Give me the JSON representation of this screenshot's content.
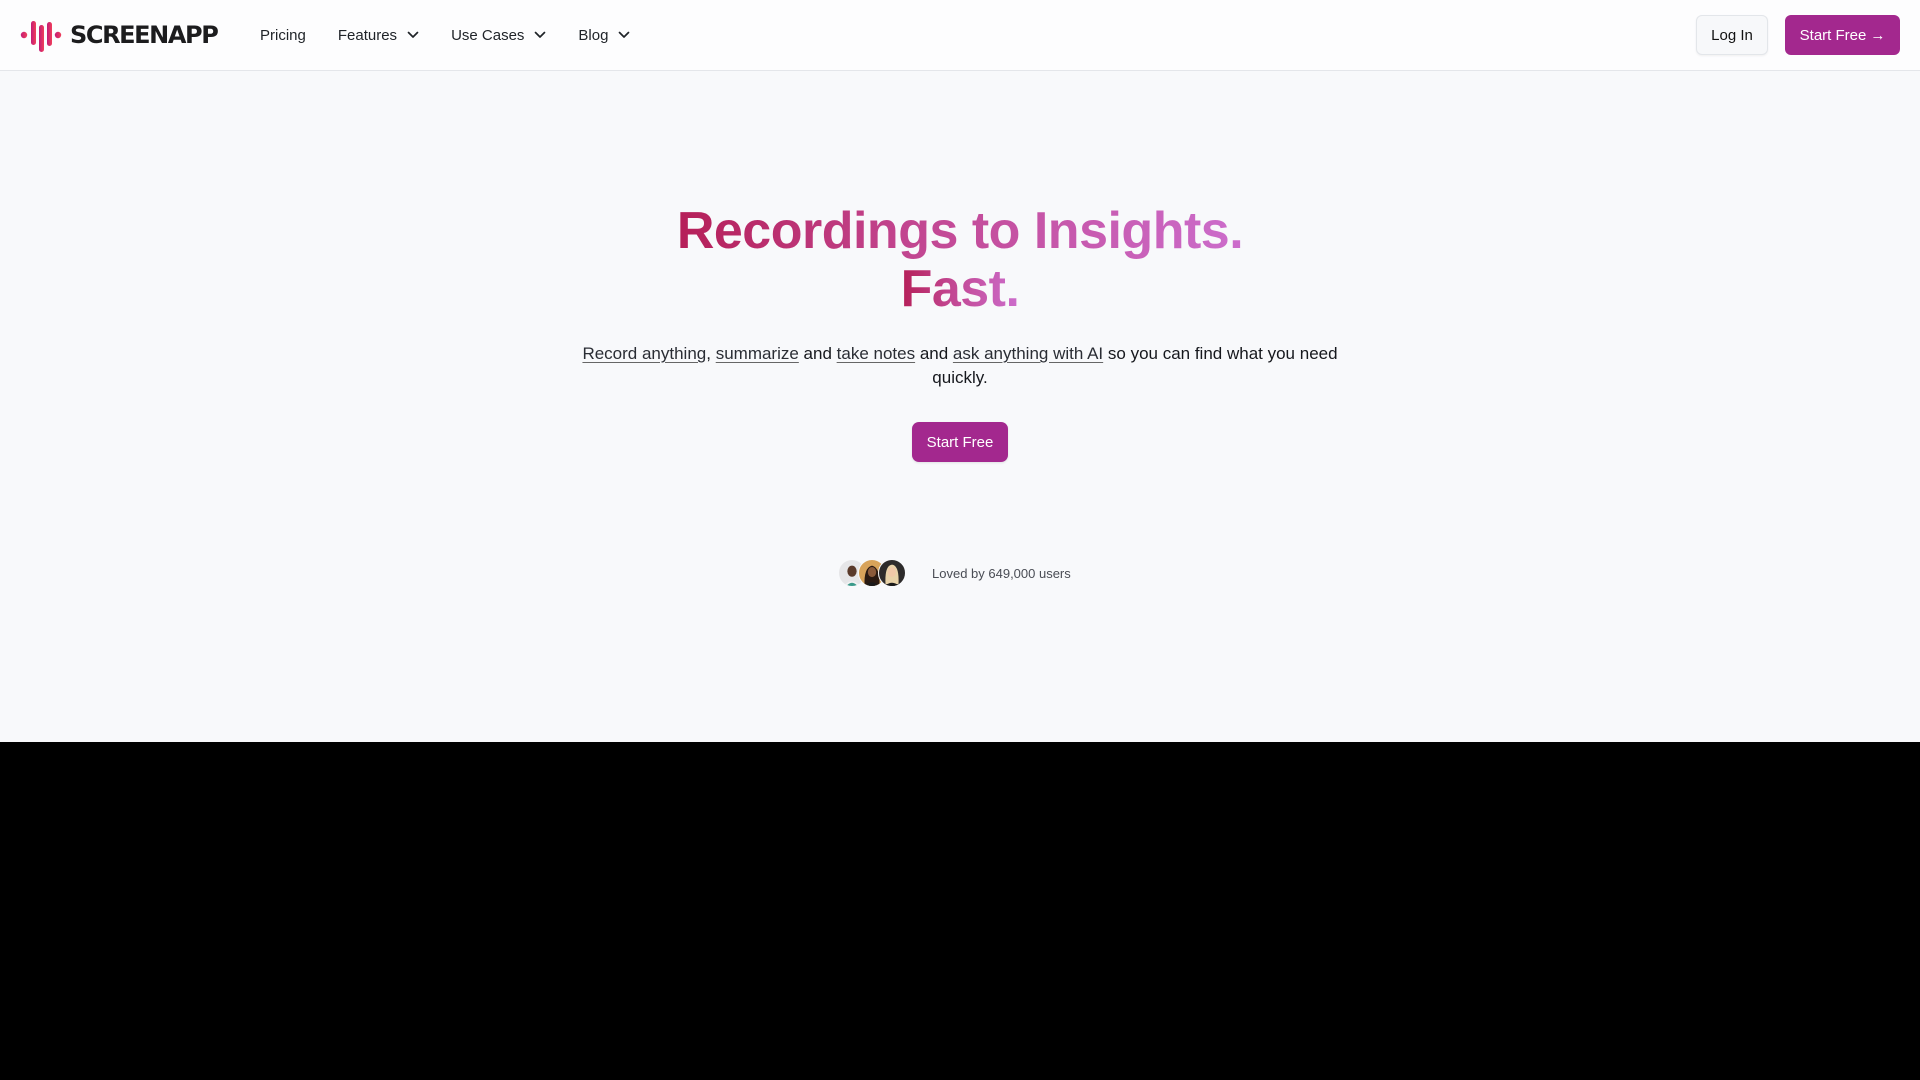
{
  "header": {
    "brand_name": "SCREENAPP",
    "logo_icon": "audio-waveform-icon",
    "nav": [
      {
        "label": "Pricing",
        "has_dropdown": false
      },
      {
        "label": "Features",
        "has_dropdown": true
      },
      {
        "label": "Use Cases",
        "has_dropdown": true
      },
      {
        "label": "Blog",
        "has_dropdown": true
      }
    ],
    "login_label": "Log In",
    "start_free_label": "Start Free",
    "start_free_arrow": "→"
  },
  "hero": {
    "title_line1": "Recordings to Insights.",
    "title_line2": "Fast.",
    "subtitle": {
      "link_record": "Record anything",
      "sep1": ", ",
      "link_summarize": "summarize",
      "text_and1": " and ",
      "link_notes": "take notes",
      "text_and2": " and ",
      "link_ask": "ask anything with AI",
      "text_tail": " so you can find what you need quickly."
    },
    "cta_label": "Start Free",
    "social_proof": {
      "avatars": [
        "user-avatar-1",
        "user-avatar-2",
        "user-avatar-3"
      ],
      "text": "Loved by 649,000 users"
    }
  },
  "colors": {
    "brand_purple": "#a3288e",
    "title_gradient_start": "#b51f58",
    "title_gradient_end": "#cc6dcc",
    "logo_gradient_start": "#c21a78",
    "logo_gradient_end": "#f0405a",
    "page_background": "#f8f9fb",
    "video_background": "#000000"
  }
}
